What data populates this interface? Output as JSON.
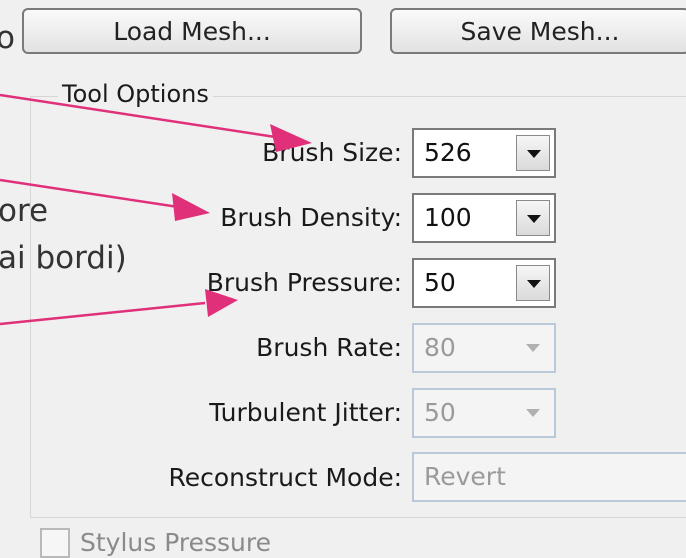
{
  "buttons": {
    "load": "Load Mesh...",
    "save": "Save Mesh..."
  },
  "edge_text": {
    "top_char": "o",
    "line1": "ore",
    "line2": "ai bordi)"
  },
  "tool_options": {
    "title": "Tool Options",
    "brush_size": {
      "label": "Brush Size:",
      "value": "526"
    },
    "brush_density": {
      "label": "Brush Density:",
      "value": "100"
    },
    "brush_pressure": {
      "label": "Brush Pressure:",
      "value": "50"
    },
    "brush_rate": {
      "label": "Brush Rate:",
      "value": "80"
    },
    "turbulent_jitter": {
      "label": "Turbulent Jitter:",
      "value": "50"
    },
    "reconstruct_mode": {
      "label": "Reconstruct Mode:",
      "value": "Revert"
    },
    "stylus_pressure": {
      "label": "Stylus Pressure"
    }
  },
  "colors": {
    "arrow": "#e0307a",
    "panel": "#f0f0f0"
  },
  "icons": [
    "dropdown-arrow-icon",
    "checkbox-icon",
    "annotation-arrow-icon"
  ]
}
